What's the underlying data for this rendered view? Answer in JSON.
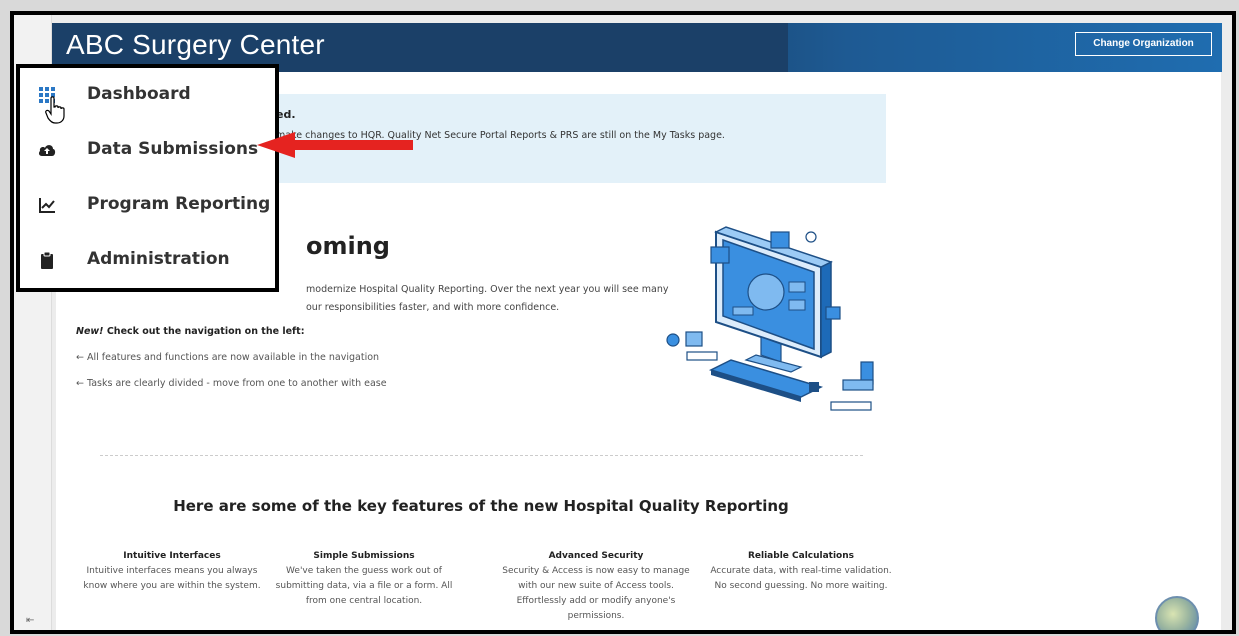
{
  "header": {
    "org_name": "ABC Surgery Center",
    "change_org_label": "Change Organization"
  },
  "alert": {
    "title_fragment": "ed.",
    "text_fragment": "make changes to HQR. Quality Net Secure Portal Reports & PRS are still on the My Tasks page."
  },
  "welcome": {
    "heading_fragment": "oming",
    "intro_line1": "modernize Hospital Quality Reporting. Over the next year you will see many",
    "intro_line2": "our responsibilities faster, and with more confidence.",
    "nav_note_new": "New!",
    "nav_note_text": "Check out the navigation on the left:",
    "bullets": [
      "← All features and functions are now available in the navigation",
      "← Tasks are clearly divided - move from one to another with ease"
    ]
  },
  "features": {
    "heading": "Here are some of the key features of the new Hospital Quality Reporting",
    "items": [
      {
        "title": "Intuitive Interfaces",
        "desc": "Intuitive interfaces means you always know where you are within the system."
      },
      {
        "title": "Simple Submissions",
        "desc": "We've taken the guess work out of submitting data, via a file or a form. All from one central location."
      },
      {
        "title": "Advanced Security",
        "desc": "Security & Access is now easy to manage with our new suite of Access tools. Effortlessly add or modify anyone's permissions."
      },
      {
        "title": "Reliable Calculations",
        "desc": "Accurate data, with real-time validation. No second guessing. No more waiting."
      }
    ]
  },
  "nav_menu": {
    "items": [
      {
        "label": "Dashboard",
        "icon": "grid-icon"
      },
      {
        "label": "Data Submissions",
        "icon": "cloud-upload-icon"
      },
      {
        "label": "Program Reporting",
        "icon": "chart-line-icon"
      },
      {
        "label": "Administration",
        "icon": "clipboard-icon"
      }
    ]
  },
  "colors": {
    "banner": "#1b4068",
    "alert_bg": "#e3f1f9",
    "arrow": "#e52320",
    "illustration_blue": "#3a8fe0"
  }
}
